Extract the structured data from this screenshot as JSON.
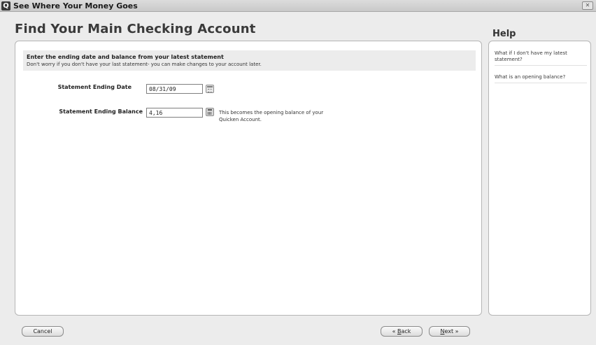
{
  "window": {
    "app_icon": "Q",
    "title": "See Where Your Money Goes",
    "close_icon": "close-icon"
  },
  "page": {
    "heading": "Find Your Main Checking Account"
  },
  "instructions": {
    "title": "Enter the ending date and balance from your latest statement",
    "subtitle": "Don't worry if you don't have your last statement- you can make changes to your account later."
  },
  "form": {
    "date_label": "Statement Ending Date",
    "date_value": "08/31/09",
    "balance_label": "Statement Ending Balance",
    "balance_value": "4,16",
    "balance_help": "This becomes the opening balance of your Quicken Account.",
    "date_picker_icon": "calendar-icon",
    "calculator_icon": "calculator-icon"
  },
  "help": {
    "heading": "Help",
    "items": [
      "What if I don't have my latest statement?",
      "What is an opening balance?"
    ]
  },
  "buttons": {
    "cancel": "Cancel",
    "back_prefix": "« ",
    "back_key": "B",
    "back_rest": "ack",
    "next_key": "N",
    "next_rest": "ext",
    "next_suffix": " »"
  }
}
